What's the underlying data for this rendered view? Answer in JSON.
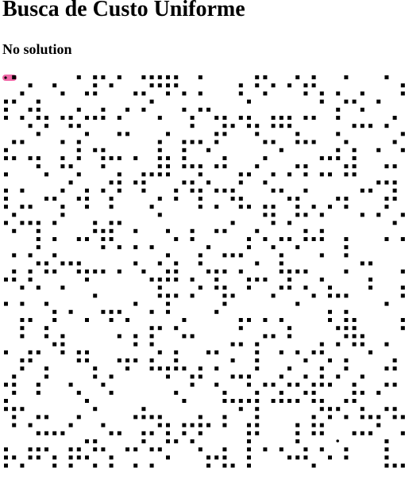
{
  "page": {
    "title": "Busca de Custo Uniforme",
    "status": "No solution"
  },
  "grid": {
    "rows": 49,
    "cols": 50,
    "start_cell": [
      0,
      0
    ],
    "goal_cell": [
      45,
      41
    ],
    "wall_density": 0.3,
    "colors": {
      "wall": "#000000",
      "open": "#ffffff",
      "start_marker": "#f06aa8",
      "goal_marker": "#000000"
    }
  }
}
